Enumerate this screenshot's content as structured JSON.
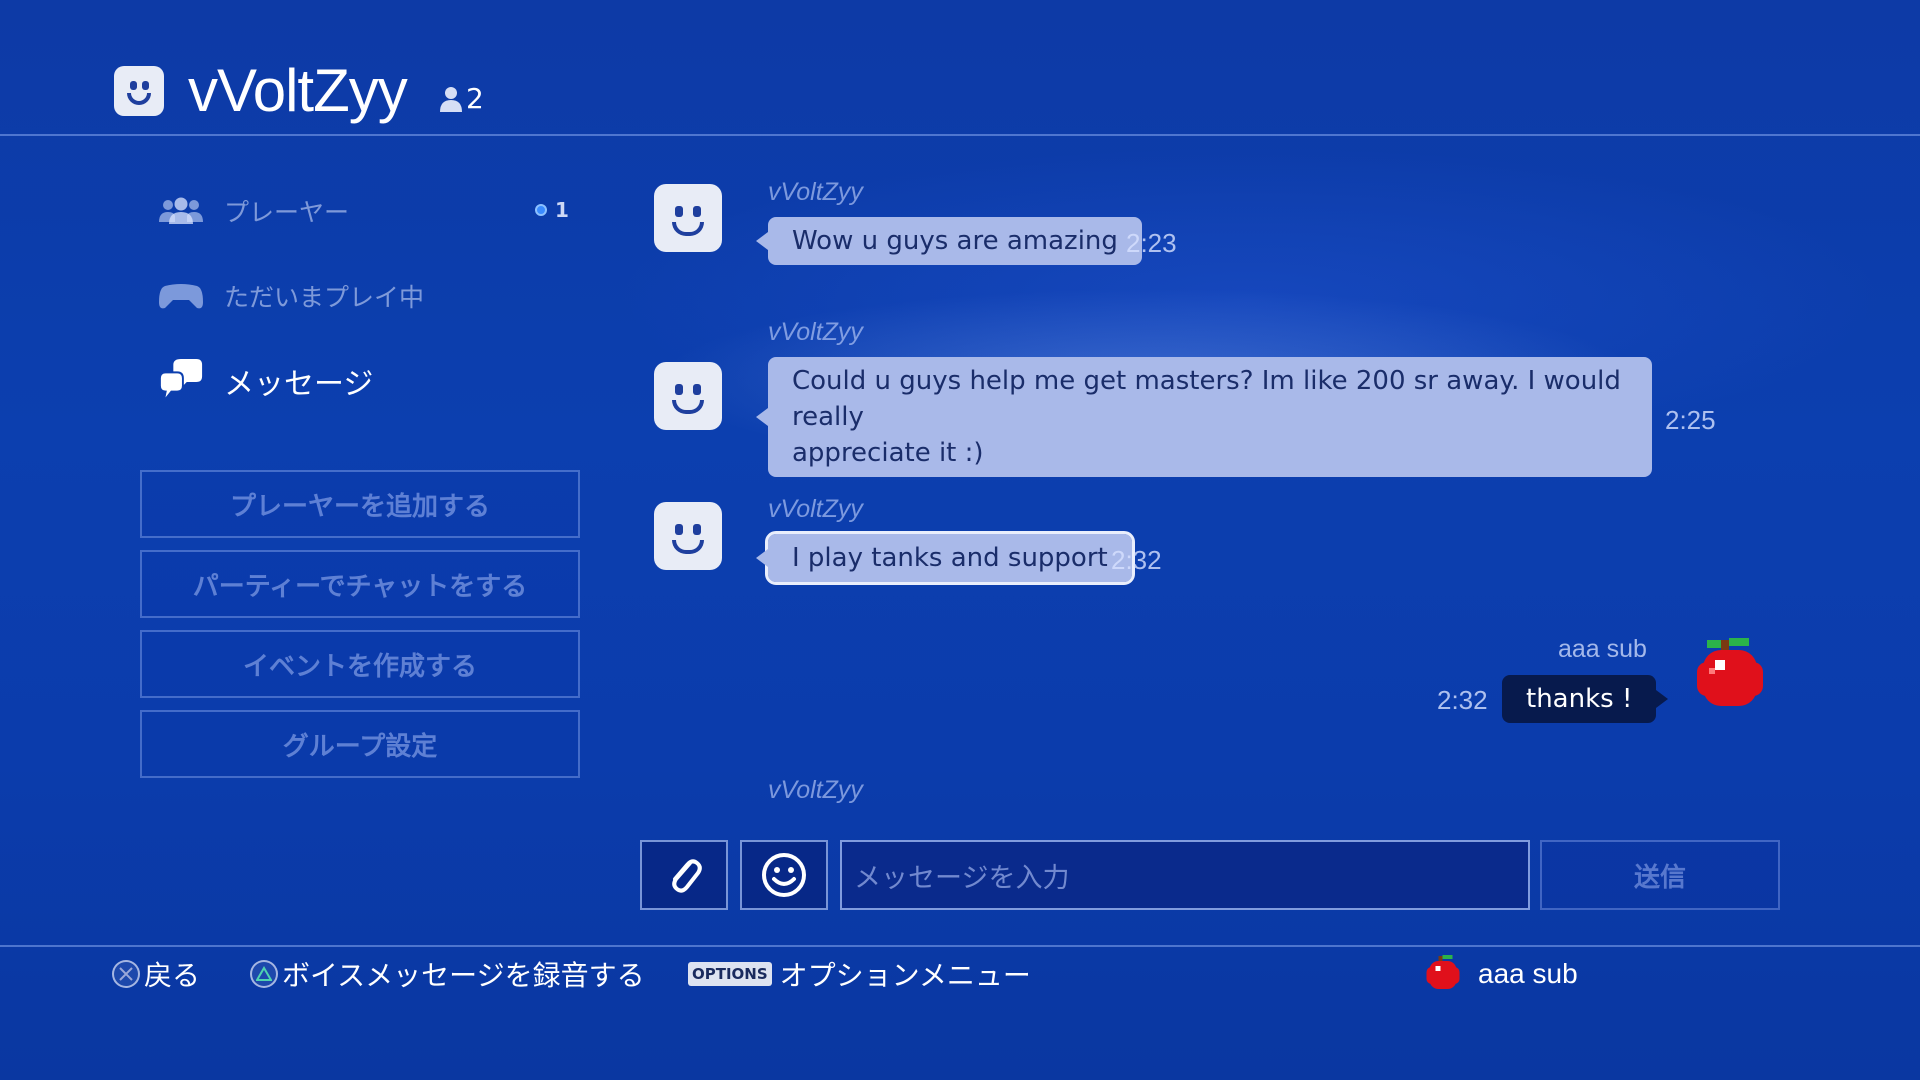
{
  "header": {
    "title": "vVoltZyy",
    "member_count": "2"
  },
  "sidebar": {
    "items": [
      {
        "label": "プレーヤー",
        "badge": "1"
      },
      {
        "label": "ただいまプレイ中"
      },
      {
        "label": "メッセージ",
        "active": true
      }
    ],
    "buttons": [
      {
        "label": "プレーヤーを追加する"
      },
      {
        "label": "パーティーでチャットをする"
      },
      {
        "label": "イベントを作成する"
      },
      {
        "label": "グループ設定"
      }
    ]
  },
  "messages": [
    {
      "sender": "vVoltZyy",
      "line1": "Wow u guys are amazing",
      "time": "2:23"
    },
    {
      "sender": "vVoltZyy",
      "line1": "Could u guys help me get masters? Im like 200 sr away. I would really",
      "line2": "appreciate it :)",
      "time": "2:25"
    },
    {
      "sender": "vVoltZyy",
      "line1": "I play tanks and support",
      "time": "2:32",
      "selected": true
    },
    {
      "sender": "aaa sub",
      "line1": "thanks !",
      "time": "2:32",
      "own": true
    },
    {
      "sender": "vVoltZyy"
    }
  ],
  "composer": {
    "placeholder": "メッセージを入力",
    "send_label": "送信",
    "attach_icon": "paperclip-icon",
    "emoji_icon": "smiley-icon"
  },
  "footer": {
    "back": "戻る",
    "voice": "ボイスメッセージを録音する",
    "options_badge": "OPTIONS",
    "options": "オプションメニュー",
    "user": "aaa sub"
  },
  "colors": {
    "background": "#0c3faf",
    "bubble_other": "#a9b9e9",
    "bubble_own": "#071a4d",
    "badge_dot": "#3a8bff"
  }
}
